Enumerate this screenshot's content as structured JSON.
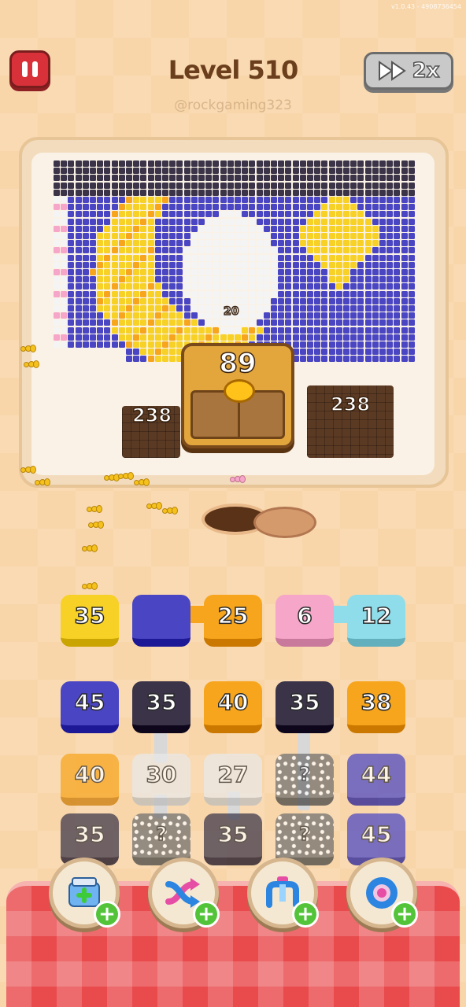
{
  "version": "v1.0.43 - 4908736454",
  "header": {
    "level_title": "Level 510",
    "username": "@rockgaming323",
    "speed_label": "2x"
  },
  "board": {
    "small_counter": "20",
    "chest_count": "89",
    "left_stack_count": "238",
    "right_stack_count": "238"
  },
  "queue": [
    {
      "label": "35",
      "color": "#f7d126"
    },
    {
      "label": "",
      "color": "#4a46c3"
    },
    {
      "label": "25",
      "color": "#f7a51c"
    },
    {
      "label": "6",
      "color": "#f6a6c8"
    },
    {
      "label": "12",
      "color": "#8fdcea"
    }
  ],
  "grid": [
    [
      {
        "label": "45",
        "color": "#4a46c3"
      },
      {
        "label": "35",
        "color": "#3b3448"
      },
      {
        "label": "40",
        "color": "#f7a51c"
      },
      {
        "label": "35",
        "color": "#3b3448"
      },
      {
        "label": "38",
        "color": "#f7a51c"
      }
    ],
    [
      {
        "label": "40",
        "color": "#f7a51c"
      },
      {
        "label": "30",
        "color": "#e9e9e9"
      },
      {
        "label": "27",
        "color": "#e9e9e9"
      },
      {
        "label": "?",
        "color": "#6e6e6e"
      },
      {
        "label": "44",
        "color": "#4a46c3"
      }
    ],
    [
      {
        "label": "35",
        "color": "#3b3448"
      },
      {
        "label": "?",
        "color": "#6e6e6e"
      },
      {
        "label": "35",
        "color": "#3b3448"
      },
      {
        "label": "?",
        "color": "#6e6e6e"
      },
      {
        "label": "45",
        "color": "#4a46c3"
      }
    ]
  ],
  "powerups": [
    {
      "name": "add-slot",
      "icon": "tray-plus-icon"
    },
    {
      "name": "shuffle",
      "icon": "shuffle-arrows-icon"
    },
    {
      "name": "magnet",
      "icon": "claw-icon"
    },
    {
      "name": "extra-hole",
      "icon": "donut-icon"
    }
  ],
  "colors": {
    "yellow": "#f7d126",
    "orange": "#f7a51c",
    "indigo": "#4a46c3",
    "dark": "#3b3448",
    "white": "#f4f4f4",
    "pink": "#f6a6c8",
    "cyan": "#8fdcea"
  }
}
